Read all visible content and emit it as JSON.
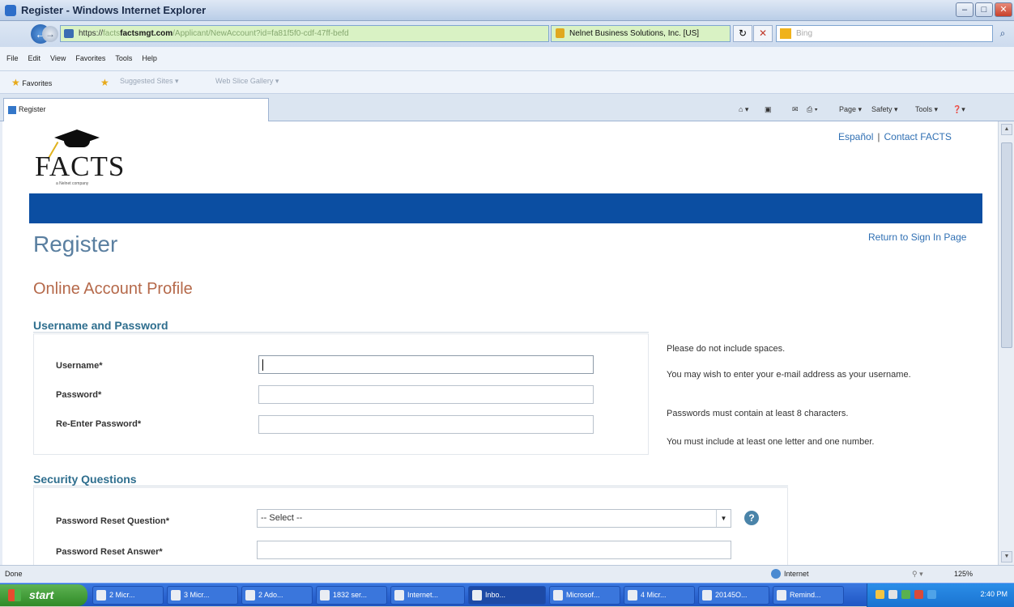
{
  "window": {
    "title": "Register - Windows Internet Explorer",
    "min": "–",
    "max": "□",
    "close": "✕"
  },
  "addressbar": {
    "url_scheme": "https://",
    "url_host": "facts",
    "url_domain": "factsmgt.com",
    "url_rest": "/Applicant/NewAccount?id=fa81f5f0-cdf-47ff-befd",
    "certificate": "Nelnet Business Solutions, Inc. [US]",
    "search_placeholder": "Bing",
    "refresh": "↻",
    "stop": "✕",
    "back": "←",
    "forward": "→",
    "search_go": "⌕"
  },
  "menubar": {
    "items": [
      "File",
      "Edit",
      "View",
      "Favorites",
      "Tools",
      "Help"
    ]
  },
  "favorites": {
    "label": "Favorites",
    "suggested": "Suggested Sites ▾",
    "gallery": "Web Slice Gallery ▾"
  },
  "tabs": {
    "active": "Register",
    "commands": [
      "Page ▾",
      "Safety ▾",
      "Tools ▾"
    ]
  },
  "page": {
    "logo_text": "FACTS",
    "logo_sub": "a Nelnet company",
    "espanol": "Español",
    "contact": "Contact FACTS",
    "title": "Register",
    "return_link": "Return to Sign In Page",
    "profile_heading": "Online Account Profile",
    "section_credentials": "Username and Password",
    "username_label": "Username*",
    "password_label": "Password*",
    "reenter_label": "Re-Enter Password*",
    "hints": [
      "Please do not include spaces.",
      "You may wish to enter your e-mail address as your username.",
      "Passwords must contain at least 8 characters.",
      "You must include at least one letter and one number."
    ],
    "section_security": "Security Questions",
    "reset_question_label": "Password Reset Question*",
    "reset_question_value": "-- Select --",
    "reset_answer_label": "Password Reset Answer*"
  },
  "statusbar": {
    "status": "Done",
    "zone": "Internet",
    "zoom": "125%"
  },
  "taskbar": {
    "start": "start",
    "tasks": [
      "2 Micr...",
      "3 Micr...",
      "2 Ado...",
      "1832 ser...",
      "Internet...",
      "Inbo...",
      "Microsof...",
      "4 Micr...",
      "20145O...",
      "Remind..."
    ],
    "clock": "2:40 PM"
  },
  "colors": {
    "brand_blue": "#0b4ea2",
    "link": "#2f6fb3",
    "profile_heading": "#b5694a",
    "section_heading": "#2e6e8e"
  }
}
